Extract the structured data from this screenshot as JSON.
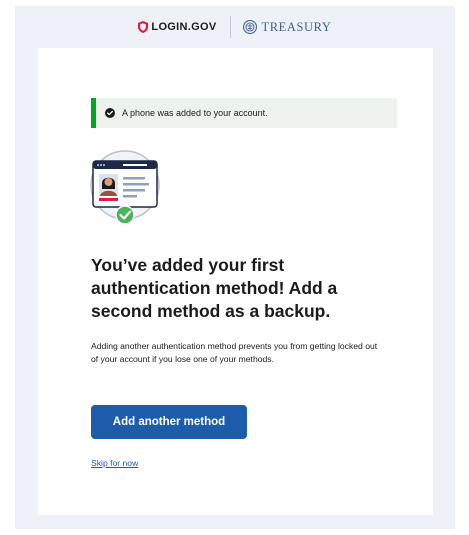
{
  "header": {
    "login_brand": "LOGIN.GOV",
    "partner_brand": "TREASURY"
  },
  "alert": {
    "type": "success",
    "message": "A phone was added to your account."
  },
  "main": {
    "title": "You’ve added your first authentication method! Add a second method as a backup.",
    "description": "Adding another authentication method prevents you from getting locked out of your account if you lose one of your methods.",
    "primary_button_label": "Add another method",
    "skip_link_label": "Skip for now"
  },
  "colors": {
    "brand_red": "#e21c3d",
    "primary_blue": "#1d5cab",
    "success_green": "#00a91c",
    "page_background": "#eef1f7"
  }
}
